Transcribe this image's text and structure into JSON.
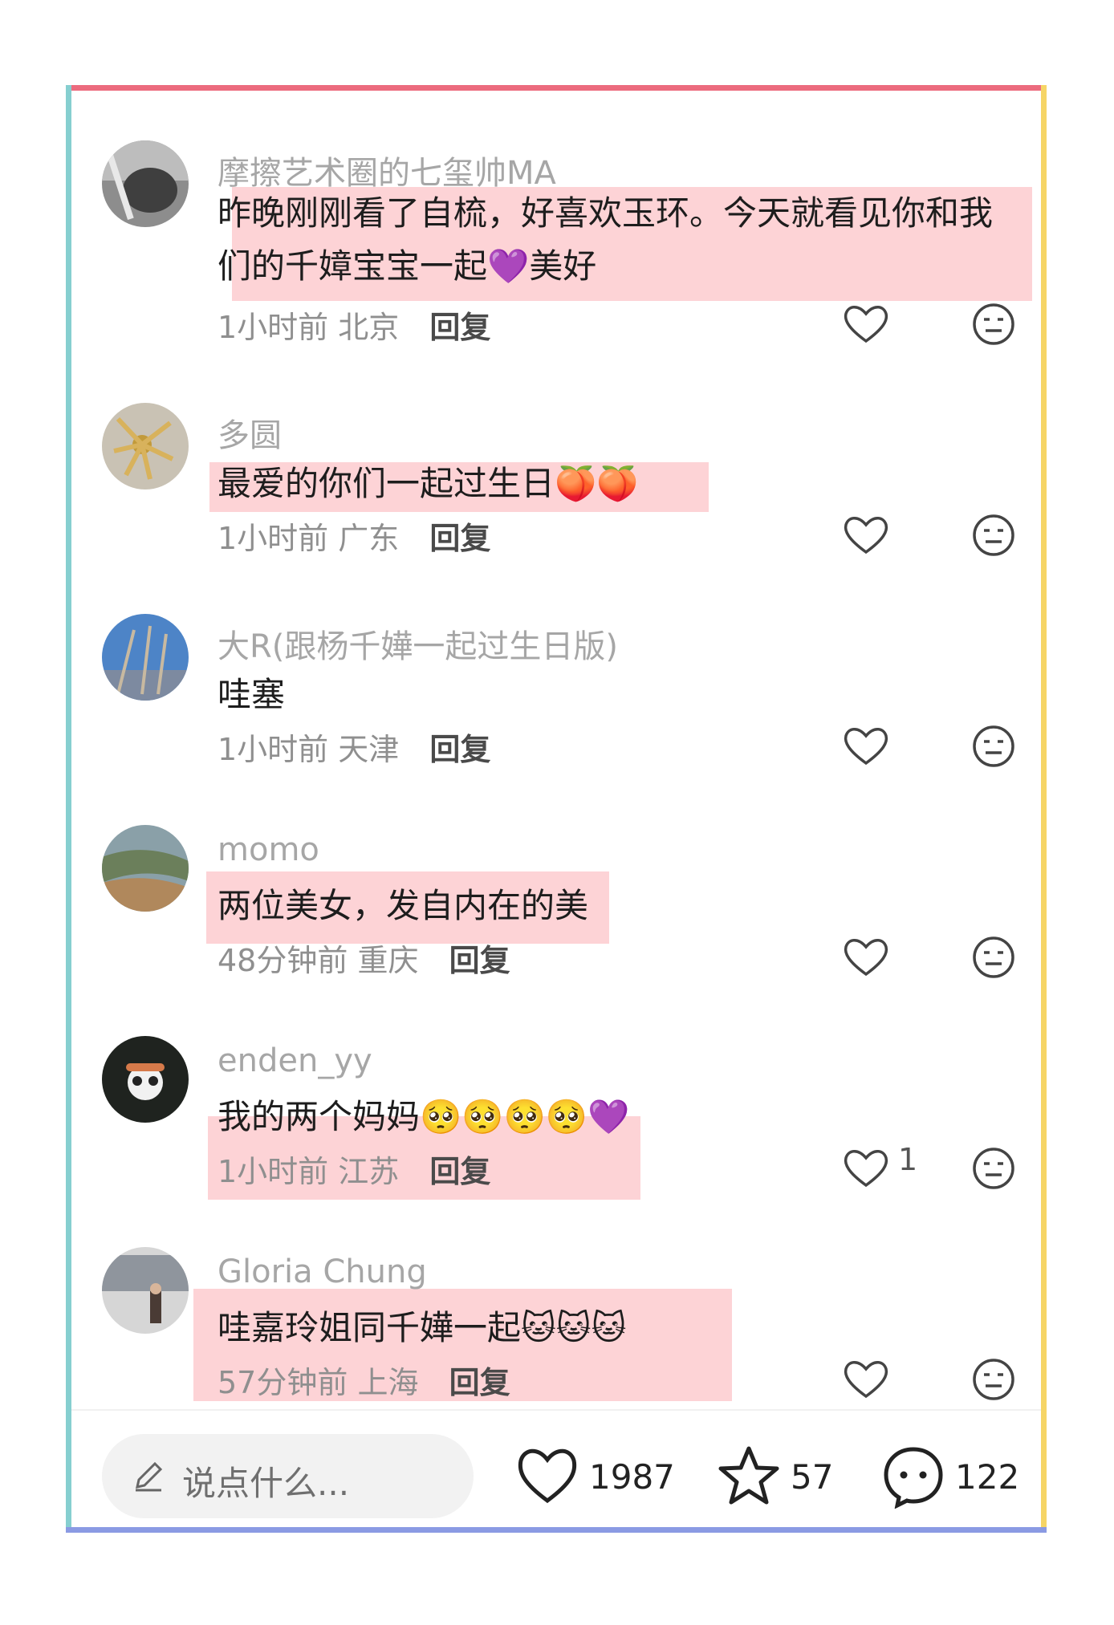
{
  "comments": [
    {
      "username": "摩擦艺术圈的七玺帅MA",
      "text_line1": "昨晚刚刚看了自梳，好喜欢玉环。今天就看见你和我",
      "text_line2": "们的千嫜宝宝一起💜美好",
      "time": "1小时前",
      "location": "北京",
      "reply": "回复",
      "likes": ""
    },
    {
      "username": "多圆",
      "text": "最爱的你们一起过生日🍑🍑",
      "time": "1小时前",
      "location": "广东",
      "reply": "回复",
      "likes": ""
    },
    {
      "username": "大R(跟杨千嬅一起过生日版)",
      "text": "哇塞",
      "time": "1小时前",
      "location": "天津",
      "reply": "回复",
      "likes": ""
    },
    {
      "username": "momo",
      "text": "两位美女，发自内在的美",
      "time": "48分钟前",
      "location": "重庆",
      "reply": "回复",
      "likes": ""
    },
    {
      "username": "enden_yy",
      "text": "我的两个妈妈🥺🥺🥺🥺💜",
      "time": "1小时前",
      "location": "江苏",
      "reply": "回复",
      "likes": "1"
    },
    {
      "username": "Gloria Chung",
      "text": "哇嘉玲姐同千嬅一起🐱🐱🐱",
      "time": "57分钟前",
      "location": "上海",
      "reply": "回复",
      "likes": ""
    }
  ],
  "bottom_bar": {
    "input_placeholder": "说点什么...",
    "like_count": "1987",
    "star_count": "57",
    "comment_count": "122"
  },
  "colors": {
    "frame_top": "#ec6b7e",
    "frame_left": "#86cfd0",
    "frame_right": "#f6d566",
    "frame_bottom": "#8a9ae3",
    "highlight": "#fdd3d6"
  }
}
